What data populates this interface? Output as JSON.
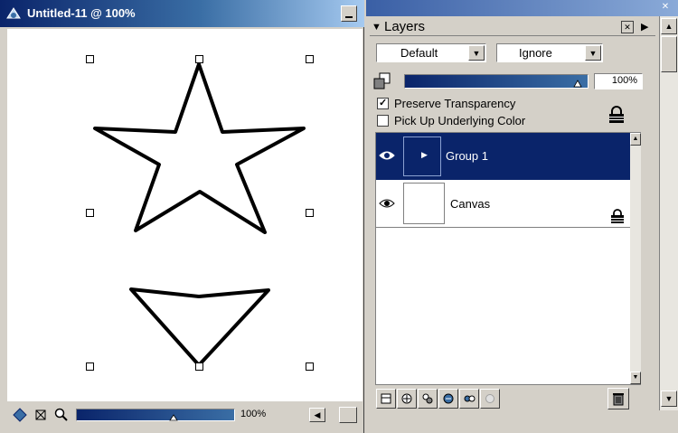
{
  "document": {
    "title": "Untitled-11 @ 100%",
    "zoom": "100%"
  },
  "layers": {
    "title": "Layers",
    "blend_mode": "Default",
    "mode": "Ignore",
    "opacity": "100%",
    "preserve_transparency": {
      "label": "Preserve Transparency",
      "checked": true
    },
    "pick_up_color": {
      "label": "Pick Up Underlying Color",
      "checked": false
    },
    "items": [
      {
        "name": "Group 1",
        "selected": true
      },
      {
        "name": "Canvas",
        "selected": false
      }
    ]
  },
  "colors": {
    "selection": "#0a246a",
    "chrome": "#d4d0c8"
  }
}
